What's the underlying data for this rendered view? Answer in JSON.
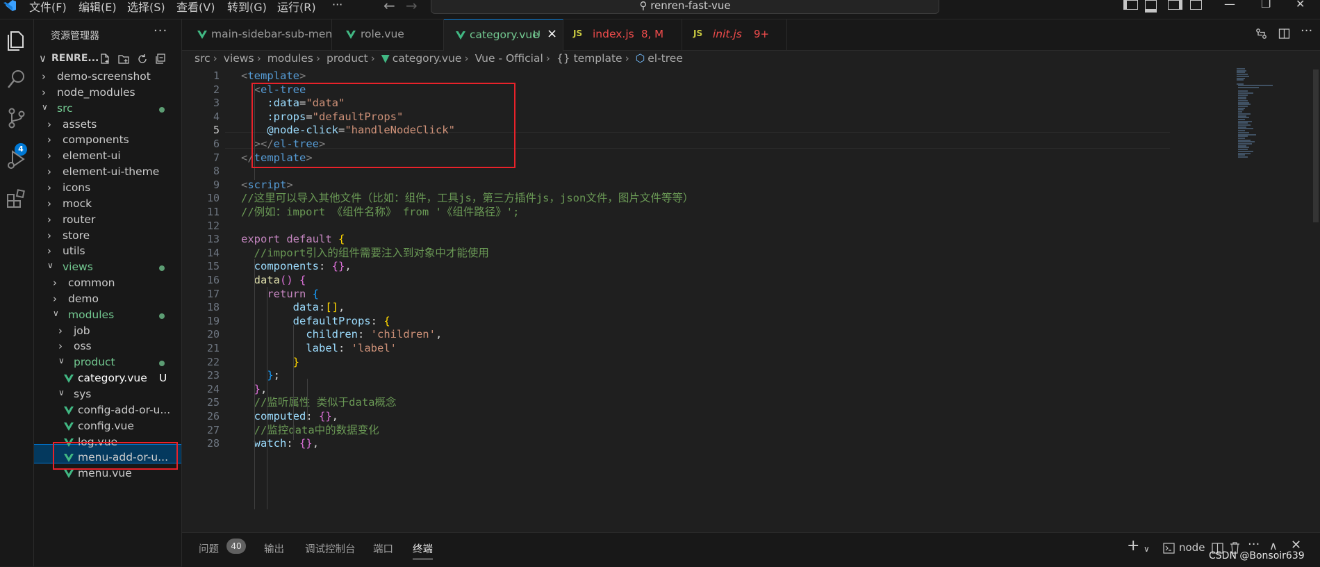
{
  "menu": [
    "文件(F)",
    "编辑(E)",
    "选择(S)",
    "查看(V)",
    "转到(G)",
    "运行(R)",
    "···"
  ],
  "command_center": "renren-fast-vue",
  "activity_badge": "4",
  "sidebar": {
    "title": "资源管理器",
    "more": "···",
    "workspace": "RENRE...",
    "tree": [
      {
        "label": "demo-screenshot",
        "depth": 1,
        "chev": ">"
      },
      {
        "label": "node_modules",
        "depth": 1,
        "chev": ">"
      },
      {
        "label": "src",
        "depth": 1,
        "chev": "v"
      },
      {
        "label": "assets",
        "depth": 2,
        "chev": ">"
      },
      {
        "label": "components",
        "depth": 2,
        "chev": ">"
      },
      {
        "label": "element-ui",
        "depth": 2,
        "chev": ">"
      },
      {
        "label": "element-ui-theme",
        "depth": 2,
        "chev": ">"
      },
      {
        "label": "icons",
        "depth": 2,
        "chev": ">"
      },
      {
        "label": "mock",
        "depth": 2,
        "chev": ">"
      },
      {
        "label": "router",
        "depth": 2,
        "chev": ">"
      },
      {
        "label": "store",
        "depth": 2,
        "chev": ">"
      },
      {
        "label": "utils",
        "depth": 2,
        "chev": ">"
      },
      {
        "label": "views",
        "depth": 2,
        "chev": "v"
      },
      {
        "label": "common",
        "depth": 3,
        "chev": ">"
      },
      {
        "label": "demo",
        "depth": 3,
        "chev": ">"
      },
      {
        "label": "modules",
        "depth": 3,
        "chev": "v"
      },
      {
        "label": "job",
        "depth": 4,
        "chev": ">"
      },
      {
        "label": "oss",
        "depth": 4,
        "chev": ">"
      },
      {
        "label": "product",
        "depth": 4,
        "chev": "v"
      },
      {
        "label": "category.vue",
        "depth": 5,
        "chev": "",
        "badge": "U"
      },
      {
        "label": "sys",
        "depth": 4,
        "chev": "v"
      },
      {
        "label": "config-add-or-u...",
        "depth": 5,
        "chev": ""
      },
      {
        "label": "config.vue",
        "depth": 5,
        "chev": ""
      },
      {
        "label": "log.vue",
        "depth": 5,
        "chev": ""
      },
      {
        "label": "menu-add-or-u...",
        "depth": 5,
        "chev": ""
      },
      {
        "label": "menu.vue",
        "depth": 5,
        "chev": ""
      }
    ]
  },
  "tabs": [
    {
      "label": "main-sidebar-sub-menu.vue",
      "kind": "vue"
    },
    {
      "label": "role.vue",
      "kind": "vue"
    },
    {
      "label": "category.vue",
      "kind": "vue",
      "badge": "U",
      "close": "×"
    },
    {
      "label": "index.js",
      "kind": "js",
      "js": "JS",
      "badge": "8, M"
    },
    {
      "label": "init.js",
      "kind": "js",
      "js": "JS",
      "badge": "9+"
    }
  ],
  "breadcrumb": [
    "src",
    "views",
    "modules",
    "product",
    "category.vue",
    "Vue - Official",
    "{} template",
    "el-tree"
  ],
  "code": [
    [
      [
        "pn",
        "<"
      ],
      [
        "tg",
        "template"
      ],
      [
        "pn",
        ">"
      ]
    ],
    [
      [
        "tx",
        "  "
      ],
      [
        "pn",
        "<"
      ],
      [
        "tg",
        "el-tree"
      ]
    ],
    [
      [
        "tx",
        "    "
      ],
      [
        "at",
        ":data"
      ],
      [
        "tx",
        "="
      ],
      [
        "st",
        "\"data\""
      ]
    ],
    [
      [
        "tx",
        "    "
      ],
      [
        "at",
        ":props"
      ],
      [
        "tx",
        "="
      ],
      [
        "st",
        "\"defaultProps\""
      ]
    ],
    [
      [
        "tx",
        "    "
      ],
      [
        "at",
        "@node-click"
      ],
      [
        "tx",
        "="
      ],
      [
        "st",
        "\"handleNodeClick\""
      ]
    ],
    [
      [
        "tx",
        "  "
      ],
      [
        "pn",
        "></"
      ],
      [
        "tg",
        "el-tree"
      ],
      [
        "pn",
        ">"
      ]
    ],
    [
      [
        "pn",
        "</"
      ],
      [
        "tg",
        "template"
      ],
      [
        "pn",
        ">"
      ]
    ],
    [],
    [
      [
        "pn",
        "<"
      ],
      [
        "tg",
        "script"
      ],
      [
        "pn",
        ">"
      ]
    ],
    [
      [
        "cm",
        "//这里可以导入其他文件（比如：组件，工具js，第三方插件js，json文件，图片文件等等）"
      ]
    ],
    [
      [
        "cm",
        "//例如：import 《组件名称》 from '《组件路径》';"
      ]
    ],
    [],
    [
      [
        "kw",
        "export default "
      ],
      [
        "b1",
        "{"
      ]
    ],
    [
      [
        "tx",
        "  "
      ],
      [
        "cm",
        "//import引入的组件需要注入到对象中才能使用"
      ]
    ],
    [
      [
        "tx",
        "  "
      ],
      [
        "pr",
        "components"
      ],
      [
        "tx",
        ": "
      ],
      [
        "b2",
        "{}"
      ],
      [
        "tx",
        ","
      ]
    ],
    [
      [
        "tx",
        "  "
      ],
      [
        "fn",
        "data"
      ],
      [
        "b2",
        "()"
      ],
      [
        "tx",
        " "
      ],
      [
        "b2",
        "{"
      ]
    ],
    [
      [
        "tx",
        "    "
      ],
      [
        "kw",
        "return "
      ],
      [
        "b3",
        "{"
      ]
    ],
    [
      [
        "tx",
        "        "
      ],
      [
        "pr",
        "data"
      ],
      [
        "tx",
        ":"
      ],
      [
        "b1",
        "[]"
      ],
      [
        "tx",
        ","
      ]
    ],
    [
      [
        "tx",
        "        "
      ],
      [
        "pr",
        "defaultProps"
      ],
      [
        "tx",
        ": "
      ],
      [
        "b1",
        "{"
      ]
    ],
    [
      [
        "tx",
        "          "
      ],
      [
        "pr",
        "children"
      ],
      [
        "tx",
        ": "
      ],
      [
        "st",
        "'children'"
      ],
      [
        "tx",
        ","
      ]
    ],
    [
      [
        "tx",
        "          "
      ],
      [
        "pr",
        "label"
      ],
      [
        "tx",
        ": "
      ],
      [
        "st",
        "'label'"
      ]
    ],
    [
      [
        "tx",
        "        "
      ],
      [
        "b1",
        "}"
      ]
    ],
    [
      [
        "tx",
        "    "
      ],
      [
        "b3",
        "}"
      ],
      [
        "tx",
        ";"
      ]
    ],
    [
      [
        "tx",
        "  "
      ],
      [
        "b2",
        "}"
      ],
      [
        "tx",
        ","
      ]
    ],
    [
      [
        "tx",
        "  "
      ],
      [
        "cm",
        "//监听属性 类似于data概念"
      ]
    ],
    [
      [
        "tx",
        "  "
      ],
      [
        "pr",
        "computed"
      ],
      [
        "tx",
        ": "
      ],
      [
        "b2",
        "{}"
      ],
      [
        "tx",
        ","
      ]
    ],
    [
      [
        "tx",
        "  "
      ],
      [
        "cm",
        "//监控data中的数据变化"
      ]
    ],
    [
      [
        "tx",
        "  "
      ],
      [
        "pr",
        "watch"
      ],
      [
        "tx",
        ": "
      ],
      [
        "b2",
        "{}"
      ],
      [
        "tx",
        ","
      ]
    ]
  ],
  "panel": {
    "tabs": [
      "问题",
      "输出",
      "调试控制台",
      "端口",
      "终端"
    ],
    "problems_count": "40",
    "terminal_name": "node",
    "plus": "+",
    "watermark": "CSDN @Bonsoir639"
  },
  "colors": {
    "accent": "#0078d4",
    "highlight": "#e8222a",
    "untracked": "#73c991",
    "modified": "#e2c08d",
    "error": "#f14c4c"
  }
}
